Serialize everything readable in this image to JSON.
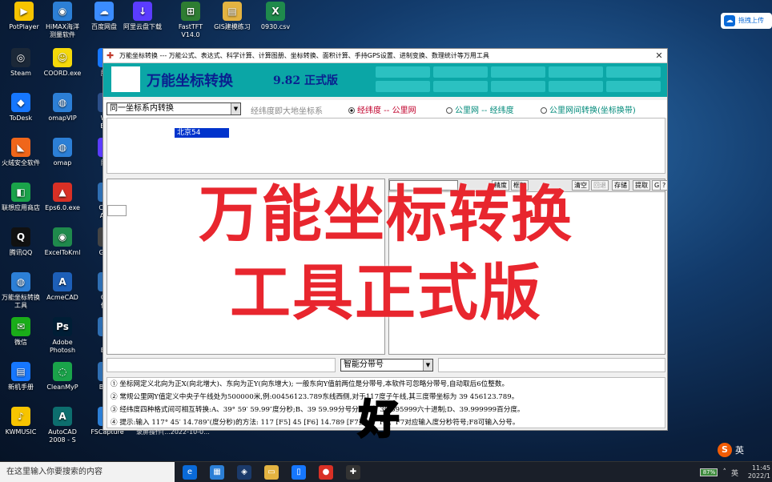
{
  "desktop": {
    "icons": [
      {
        "label": "PotPlayer",
        "color": "#f7c400",
        "glyph": "▶"
      },
      {
        "label": "HiMAX海洋\n测量软件",
        "color": "#2c7fd6",
        "glyph": "◉"
      },
      {
        "label": "百度网盘",
        "color": "#3b8cff",
        "glyph": "☁"
      },
      {
        "label": "阿里云盘下载",
        "color": "#5b3cff",
        "glyph": "↓"
      },
      {
        "label": "FastTFT\nV14.0",
        "color": "#2e7d32",
        "glyph": "⊞"
      },
      {
        "label": "GIS建模练习",
        "color": "#e3b341",
        "glyph": "▤"
      },
      {
        "label": "0930.csv",
        "color": "#1f8a4c",
        "glyph": "X"
      },
      {
        "label": "Steam",
        "color": "#1b2838",
        "glyph": "◎"
      },
      {
        "label": "COORD.exe",
        "color": "#f5d90a",
        "glyph": "☺"
      },
      {
        "label": "腾讯",
        "color": "#1677ff",
        "glyph": "Q"
      },
      {
        "label": "ToDesk",
        "color": "#1677ff",
        "glyph": "◆"
      },
      {
        "label": "omapVIP",
        "color": "#2c7fd6",
        "glyph": "◍"
      },
      {
        "label": "Wall\nEngi",
        "color": "#2c4f8a",
        "glyph": "▣"
      },
      {
        "label": "火绒安全软件",
        "color": "#f0661a",
        "glyph": "◣"
      },
      {
        "label": "omap",
        "color": "#2c7fd6",
        "glyph": "◍"
      },
      {
        "label": "阿里",
        "color": "#5b3cff",
        "glyph": "◈"
      },
      {
        "label": "联想应用商店",
        "color": "#1aa34a",
        "glyph": "◧"
      },
      {
        "label": "Eps6.0.exe",
        "color": "#d93025",
        "glyph": "▲"
      },
      {
        "label": "CASS\nAuto",
        "color": "#2f6fb3",
        "glyph": "C"
      },
      {
        "label": "腾讯QQ",
        "color": "#111111",
        "glyph": "Q"
      },
      {
        "label": "ExcelToKml",
        "color": "#1f8a4c",
        "glyph": "◉"
      },
      {
        "label": "Geek",
        "color": "#444444",
        "glyph": "G"
      },
      {
        "label": "万能坐标转换\n工具",
        "color": "#2c7fd6",
        "glyph": "◍"
      },
      {
        "label": "AcmeCAD",
        "color": "#1d5fb8",
        "glyph": "A"
      },
      {
        "label": "GEE\n修复",
        "color": "#2f6fb3",
        "glyph": "G"
      },
      {
        "label": "微信",
        "color": "#1aad19",
        "glyph": "✉"
      },
      {
        "label": "Adobe\nPhotosh",
        "color": "#001e36",
        "glyph": "Ps"
      },
      {
        "label": "Go\nEart",
        "color": "#2f6fb3",
        "glyph": "◐"
      },
      {
        "label": "新机手册",
        "color": "#1677ff",
        "glyph": "▤"
      },
      {
        "label": "CleanMyP",
        "color": "#1aa34a",
        "glyph": "◌"
      },
      {
        "label": "Band",
        "color": "#2f6fb3",
        "glyph": "B"
      },
      {
        "label": "KWMUSIC",
        "color": "#f7c400",
        "glyph": "♪"
      },
      {
        "label": "AutoCAD\n2008 - S",
        "color": "#0d6e6e",
        "glyph": "A"
      },
      {
        "label": "FSCapture",
        "color": "#2c7fd6",
        "glyph": "▣"
      }
    ],
    "upload_label": "拖拽上传"
  },
  "window": {
    "title": "万能坐标转换 --- 万能公式、表达式、科学计算、计算图册、坐标转换、面积计算、手持GPS设置、进制变换、数理统计等万用工具",
    "close_glyph": "✕",
    "app_title": "万能坐标转换",
    "version": "9.82 正式版",
    "mode_select": "同一坐标系内转换",
    "mode_hint": "经纬度即大地坐标系",
    "radio_options": [
      {
        "label": "经纬度 -- 公里网",
        "selected": true,
        "color": "#c0002b"
      },
      {
        "label": "公里网 -- 经纬度",
        "selected": false,
        "color": "#008a7a"
      },
      {
        "label": "公里网间转换(坐标换带)",
        "selected": false,
        "color": "#008a7a"
      }
    ],
    "datum_chip": "北京54",
    "toolbar_buttons": [
      "精度",
      "框架",
      "清空",
      "回退",
      "存储",
      "提取",
      "G",
      "?"
    ],
    "zone_select": "智能分带号",
    "notes": [
      "① 坐标网定义北向为正X(向北增大)、东向为正Y(向东增大); 一般东向Y值前两位是分带号,本软件可忽略分带号,自动取后6位整数。",
      "② 常规公里网Y值定义中央子午线处为500000米,例:00456123.789东线西侧,对于117度子午线,其三度带坐标为 39 456123.789。",
      "③ 经纬度四种格式间可相互转换:A、39° 59′ 59.99″度分秒;B、39 59.99分号分别;C、39.595999六十进制;D、39.999999百分度。",
      "④ 提示:输入 117° 45′ 14.789″(度分秒)的方法: 117 [F5] 45 [F6] 14.789 [F7],F5、F6、F7对应输入度分秒符号;F8可输入分号。"
    ]
  },
  "overlay": {
    "title_line1": "万能坐标转换",
    "title_line2": "工具正式版",
    "subtitle_char": "好",
    "bottom_caption": "录屏操作(...2022-10-0..."
  },
  "taskbar": {
    "search_placeholder": "在这里输入你要搜索的内容",
    "battery": "87%",
    "time": "11:45",
    "date": "2022/1",
    "ime": "英",
    "sogou": "S"
  }
}
